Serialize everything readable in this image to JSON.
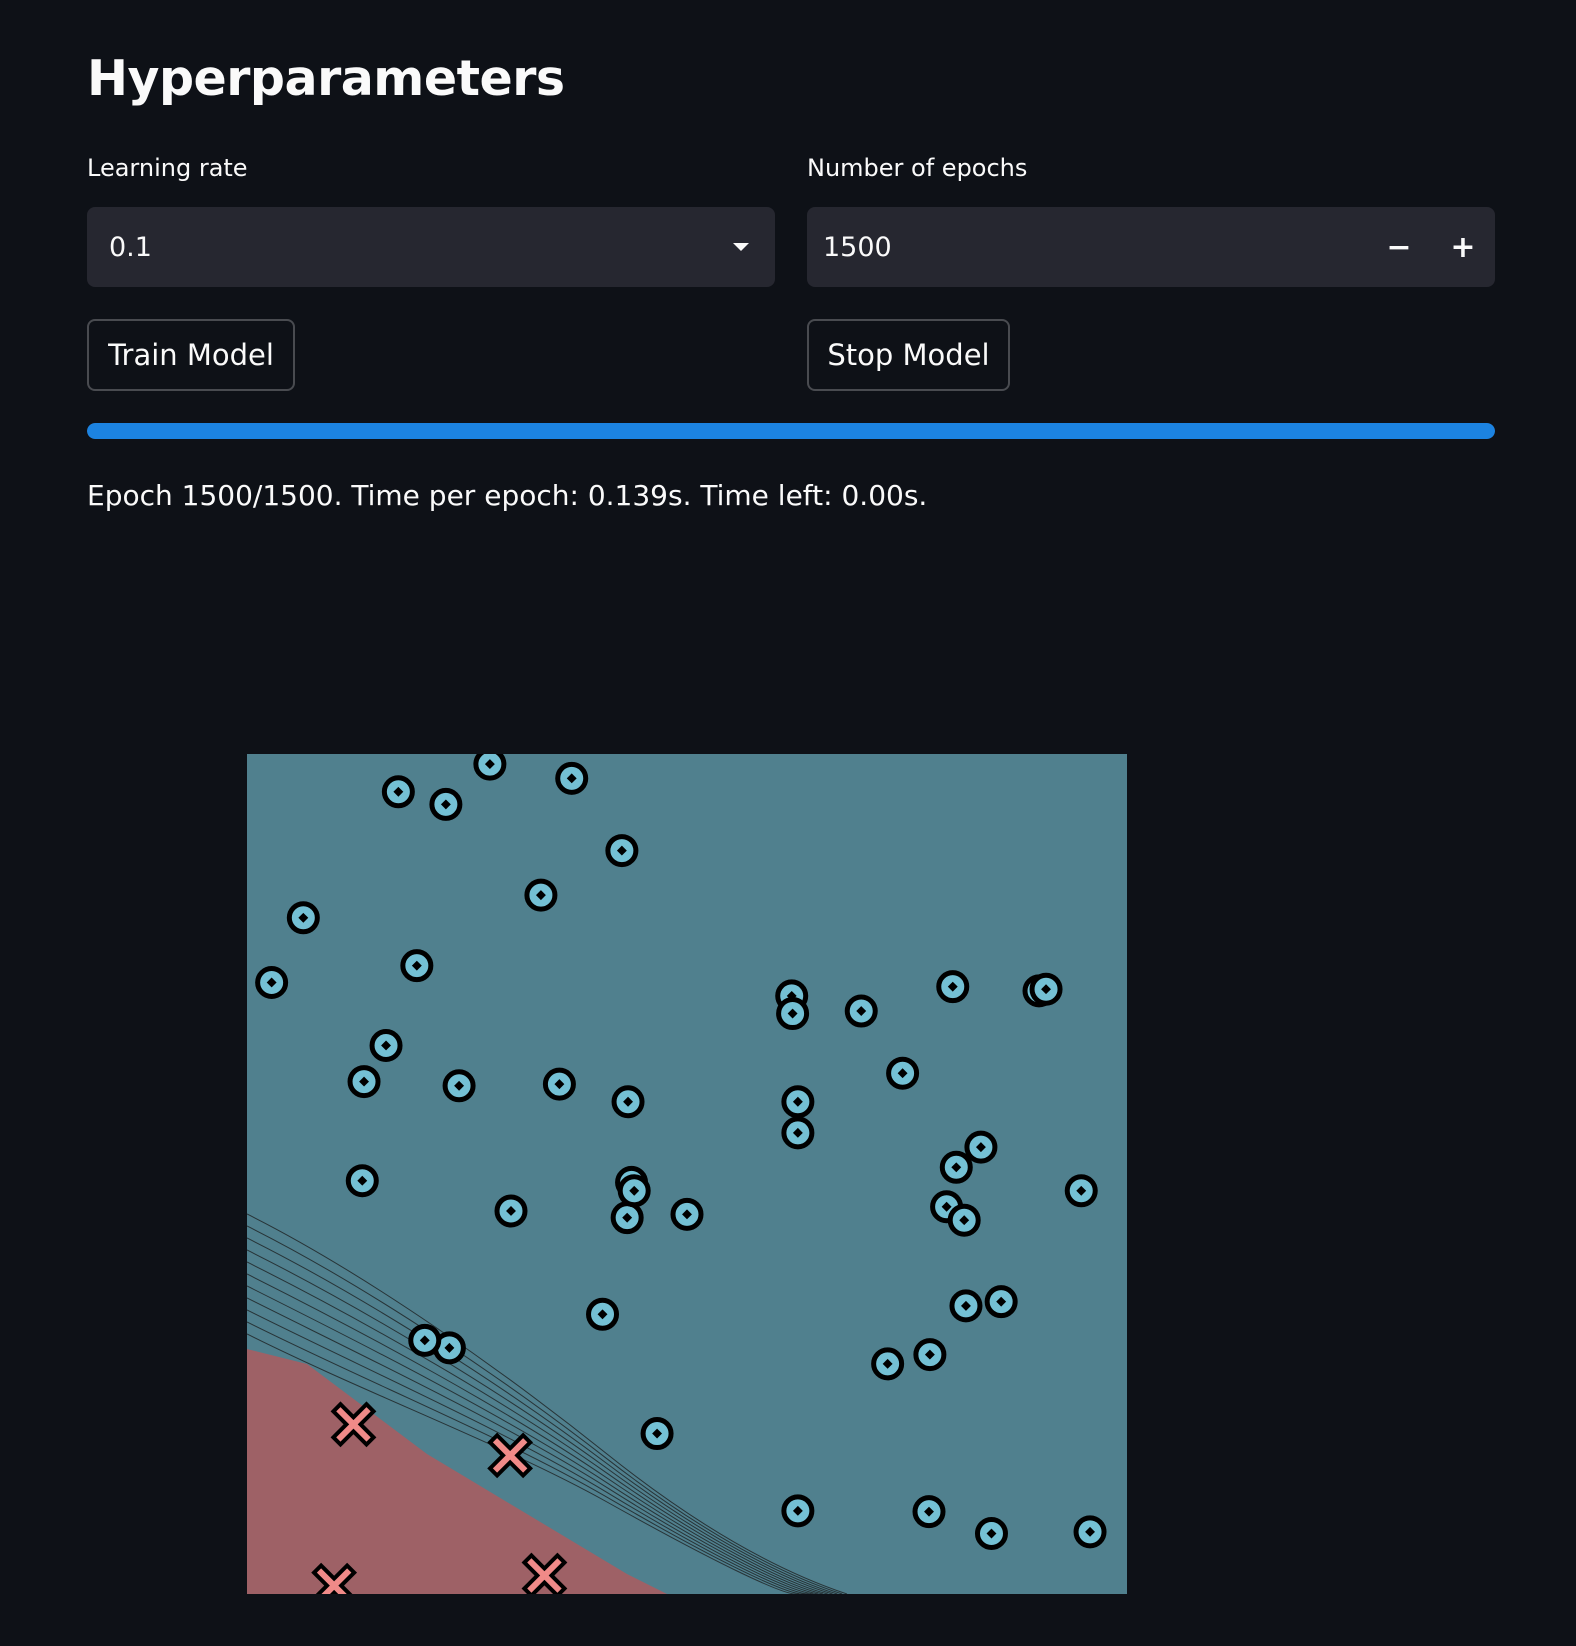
{
  "page": {
    "title": "Hyperparameters"
  },
  "learning_rate": {
    "label": "Learning rate",
    "selected": "0.1"
  },
  "epochs": {
    "label": "Number of epochs",
    "value": "1500",
    "minus": "−",
    "plus": "+"
  },
  "buttons": {
    "train": "Train Model",
    "stop": "Stop Model"
  },
  "progress": {
    "fraction": 1.0,
    "color": "#1c83e1",
    "status": "Epoch 1500/1500. Time per epoch: 0.139s. Time left: 0.00s."
  },
  "chart_data": {
    "type": "scatter",
    "title": "",
    "xlabel": "",
    "ylabel": "",
    "xlim": [
      0,
      1
    ],
    "ylim": [
      0,
      1
    ],
    "grid": false,
    "legend": "none",
    "background": {
      "class_circle_region_color": "#50808e",
      "class_x_region_color": "#9e6166"
    },
    "series": [
      {
        "marker": "circle",
        "color": "#74c0d4",
        "points": [
          [
            0.276,
            0.988
          ],
          [
            0.172,
            0.955
          ],
          [
            0.226,
            0.94
          ],
          [
            0.369,
            0.971
          ],
          [
            0.426,
            0.885
          ],
          [
            0.334,
            0.832
          ],
          [
            0.064,
            0.805
          ],
          [
            0.193,
            0.748
          ],
          [
            0.028,
            0.728
          ],
          [
            0.158,
            0.653
          ],
          [
            0.133,
            0.61
          ],
          [
            0.241,
            0.605
          ],
          [
            0.355,
            0.607
          ],
          [
            0.433,
            0.586
          ],
          [
            0.131,
            0.492
          ],
          [
            0.3,
            0.456
          ],
          [
            0.432,
            0.448
          ],
          [
            0.437,
            0.49
          ],
          [
            0.44,
            0.48
          ],
          [
            0.5,
            0.452
          ],
          [
            0.23,
            0.293
          ],
          [
            0.202,
            0.302
          ],
          [
            0.404,
            0.333
          ],
          [
            0.466,
            0.191
          ],
          [
            0.619,
            0.712
          ],
          [
            0.62,
            0.691
          ],
          [
            0.698,
            0.694
          ],
          [
            0.802,
            0.723
          ],
          [
            0.9,
            0.718
          ],
          [
            0.908,
            0.72
          ],
          [
            0.745,
            0.62
          ],
          [
            0.626,
            0.586
          ],
          [
            0.626,
            0.549
          ],
          [
            0.834,
            0.532
          ],
          [
            0.806,
            0.508
          ],
          [
            0.948,
            0.48
          ],
          [
            0.795,
            0.461
          ],
          [
            0.815,
            0.445
          ],
          [
            0.817,
            0.343
          ],
          [
            0.857,
            0.348
          ],
          [
            0.776,
            0.285
          ],
          [
            0.728,
            0.274
          ],
          [
            0.626,
            0.099
          ],
          [
            0.775,
            0.098
          ],
          [
            0.846,
            0.072
          ],
          [
            0.958,
            0.074
          ]
        ]
      },
      {
        "marker": "x",
        "color": "#f08a88",
        "points": [
          [
            0.121,
            0.202
          ],
          [
            0.299,
            0.165
          ],
          [
            0.099,
            0.01
          ],
          [
            0.338,
            0.022
          ]
        ]
      }
    ]
  }
}
